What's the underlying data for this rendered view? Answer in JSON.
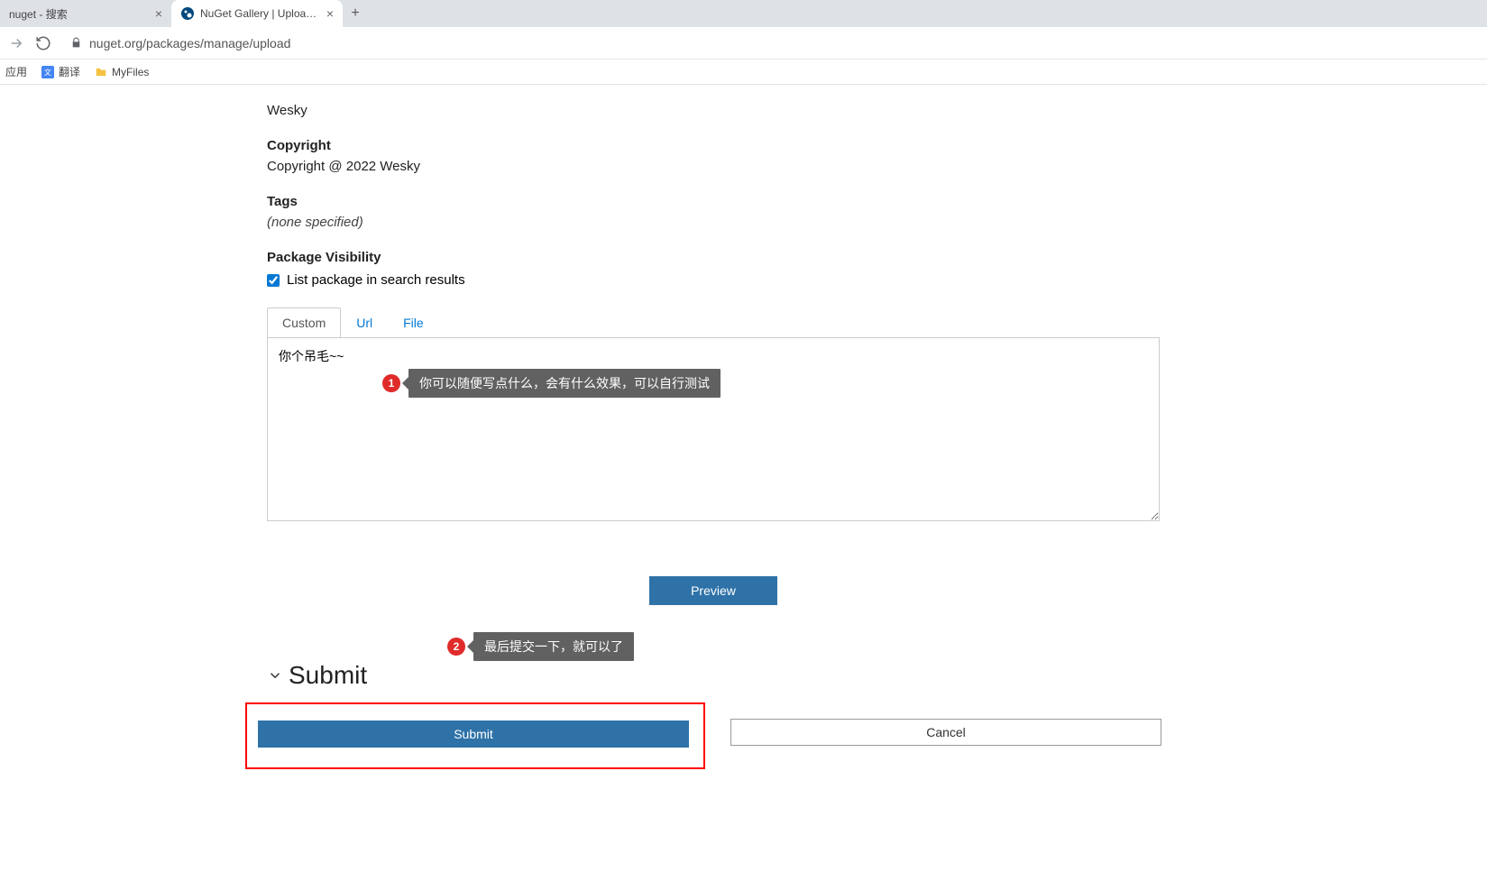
{
  "browser": {
    "tabs": [
      {
        "title": "nuget - 搜索",
        "active": false
      },
      {
        "title": "NuGet Gallery | Upload Packa",
        "active": true
      }
    ],
    "url": "nuget.org/packages/manage/upload",
    "bookmarks": {
      "apps": "应用",
      "translate": "翻译",
      "myfiles": "MyFiles"
    }
  },
  "page": {
    "author_value": "Wesky",
    "copyright_title": "Copyright",
    "copyright_value": "Copyright @ 2022 Wesky",
    "tags_title": "Tags",
    "tags_value": "(none specified)",
    "visibility_title": "Package Visibility",
    "visibility_checkbox": "List package in search results",
    "visibility_checked": true,
    "tabs": {
      "custom": "Custom",
      "url": "Url",
      "file": "File"
    },
    "textarea_value": "你个吊毛~~",
    "annotations": {
      "a1_num": "1",
      "a1_text": "你可以随便写点什么，会有什么效果，可以自行测试",
      "a2_num": "2",
      "a2_text": "最后提交一下，就可以了"
    },
    "preview_label": "Preview",
    "submit_heading": "Submit",
    "submit_label": "Submit",
    "cancel_label": "Cancel"
  }
}
